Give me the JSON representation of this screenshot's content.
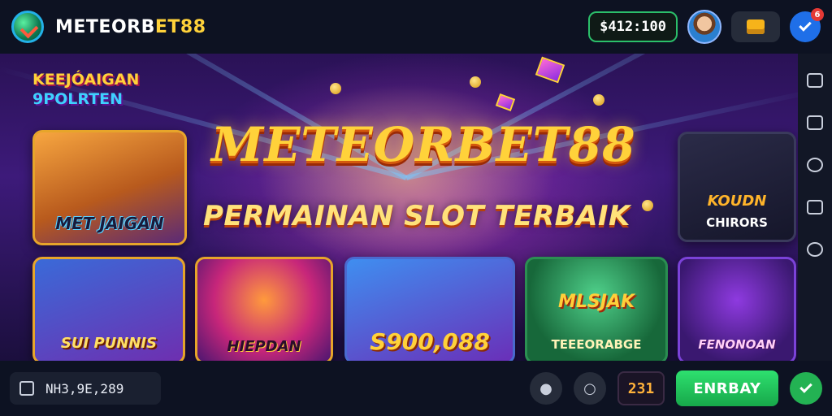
{
  "header": {
    "brand_part1": "METEORB",
    "brand_part2": "ET88",
    "balance": "$412:100",
    "notification_count": "6"
  },
  "hero": {
    "promo_line1": "KEEJÓAIGAN",
    "promo_line2": "9POLRTEN",
    "title": "METEORBET88",
    "subtitle": "PERMAINAN SLOT TERBAIK"
  },
  "games": [
    {
      "label": "MET JAIGAN"
    },
    {
      "label1": "KOUDN",
      "label2": "CHIRORS"
    },
    {
      "label": "SUI PUNNIS"
    },
    {
      "label": "HIEPDAN"
    },
    {
      "label": "S900,088"
    },
    {
      "label1": "MLSJAK",
      "label2": "TEEEORABGE"
    },
    {
      "label": "FENONOAN"
    }
  ],
  "footer": {
    "account_number": "NH3,9E,289",
    "counter": "231",
    "cta_label": "ENRBAY"
  },
  "colors": {
    "accent_gold": "#ffd23a",
    "cta_green": "#23b253",
    "notification_blue": "#1f6fe8"
  }
}
